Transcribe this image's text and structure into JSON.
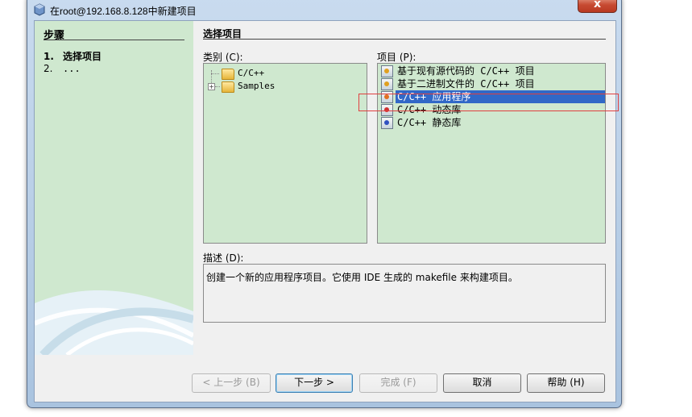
{
  "window": {
    "title": "在root@192.168.8.128中新建项目",
    "close_symbol": "x"
  },
  "steps": {
    "heading": "步骤",
    "items": [
      {
        "num": "1.",
        "label": "选择项目"
      },
      {
        "num": "2.",
        "label": "..."
      }
    ]
  },
  "panel": {
    "title": "选择项目",
    "categories_label": "类别 (C):",
    "projects_label": "项目 (P):",
    "description_label": "描述 (D):",
    "categories": [
      {
        "label": "C/C++"
      },
      {
        "label": "Samples"
      }
    ],
    "projects": [
      {
        "label": "基于现有源代码的 C/C++ 项目",
        "icon": "project-template-icon"
      },
      {
        "label": "基于二进制文件的 C/C++ 项目",
        "icon": "project-template-icon"
      },
      {
        "label": "C/C++ 应用程序",
        "icon": "application-icon",
        "selected": true
      },
      {
        "label": "C/C++ 动态库",
        "icon": "dynamic-library-icon"
      },
      {
        "label": "C/C++ 静态库",
        "icon": "static-library-icon"
      }
    ],
    "description": "创建一个新的应用程序项目。它使用 IDE 生成的 makefile 来构建项目。"
  },
  "buttons": {
    "back": "< 上一步 (B)",
    "next": "下一步 >",
    "finish": "完成 (F)",
    "cancel": "取消",
    "help": "帮助 (H)"
  },
  "colors": {
    "pane_background": "#cfe8cf",
    "selection": "#3168c7",
    "highlight_box": "#e04040"
  }
}
